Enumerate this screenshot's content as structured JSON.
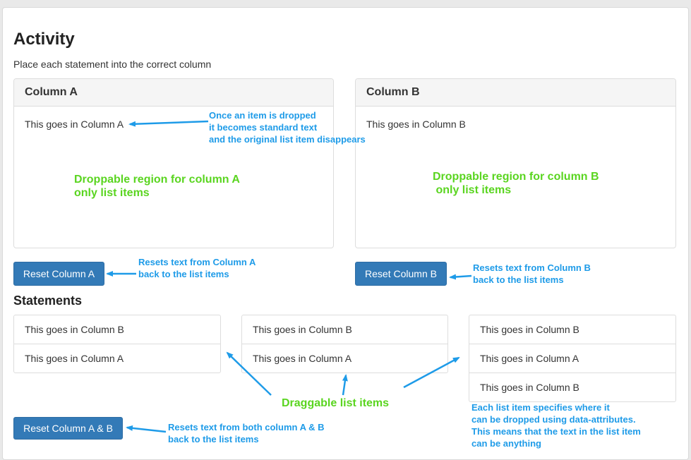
{
  "activity": {
    "title": "Activity",
    "instructions": "Place each statement into the correct column"
  },
  "columns": [
    {
      "heading": "Column A",
      "dropped_item": "This goes in Column A",
      "reset_label": "Reset Column A"
    },
    {
      "heading": "Column B",
      "dropped_item": "This goes in Column B",
      "reset_label": "Reset Column B"
    }
  ],
  "statements": {
    "heading": "Statements",
    "lists": [
      [
        "This goes in Column B",
        "This goes in Column A"
      ],
      [
        "This goes in Column B",
        "This goes in Column A"
      ],
      [
        "This goes in Column B",
        "This goes in Column A",
        "This goes in Column B"
      ]
    ],
    "reset_all_label": "Reset Column A & B"
  },
  "annotations": {
    "dropped_note": "Once an item is dropped\nit becomes standard text\nand the original list item disappears",
    "region_a_note": "Droppable region for column A\nonly list items",
    "region_b_note": "Droppable region for column B\n only list items",
    "reset_a_note": "Resets text from Column A\nback to the list items",
    "reset_b_note": "Resets text from Column B\nback to the list items",
    "draggable_note": "Draggable list items",
    "data_attr_note": "Each list item specifies where it\ncan be dropped using data-attributes.\nThis means that the text in the list item\ncan be anything",
    "reset_all_note": "Resets text from both column A & B\nback to the list items"
  },
  "colors": {
    "primary_button": "#337ab7",
    "annotation_blue": "#1e9be8",
    "annotation_green": "#5ad520"
  }
}
